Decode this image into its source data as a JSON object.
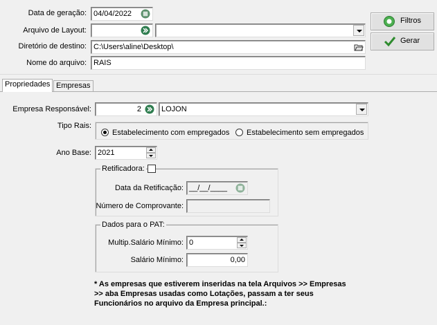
{
  "top": {
    "data_geracao_label": "Data de geração:",
    "data_geracao_value": "04/04/2022",
    "arquivo_layout_label": "Arquivo de Layout:",
    "arquivo_layout_code": "",
    "arquivo_layout_name": "",
    "diretorio_label": "Diretório de destino:",
    "diretorio_value": "C:\\Users\\aline\\Desktop\\",
    "nome_arquivo_label": "Nome do arquivo:",
    "nome_arquivo_value": "RAIS"
  },
  "buttons": {
    "filtros": "Filtros",
    "gerar": "Gerar"
  },
  "tabs": [
    {
      "label": "Propriedades"
    },
    {
      "label": "Empresas"
    }
  ],
  "props": {
    "empresa_label": "Empresa Responsável:",
    "empresa_code": "2",
    "empresa_name": "LOJON",
    "tipo_rais_label": "Tipo Rais:",
    "radio_com": "Estabelecimento com empregados",
    "radio_sem": "Estabelecimento sem empregados",
    "ano_base_label": "Ano Base:",
    "ano_base_value": "2021",
    "retificadora_label": "Retificadora:",
    "data_retificacao_label": "Data da Retificação:",
    "data_retificacao_value": "__/__/____",
    "numero_comprovante_label": "Número de Comprovante:",
    "numero_comprovante_value": "",
    "pat_title": "Dados para o PAT:",
    "mult_salario_label": "Multip.Salário Mínimo:",
    "mult_salario_value": "0",
    "salario_minimo_label": "Salário Mínimo:",
    "salario_minimo_value": "0,00",
    "note_line1": "* As empresas que estiverem inseridas na tela Arquivos >> Empresas",
    "note_line2": ">> aba Empresas usadas como Lotações, passam a ter seus",
    "note_line3": "Funcionários no arquivo da Empresa principal.:"
  },
  "colors": {
    "filtros_icon": "#3c9a3c",
    "go_icon": "#2e8b57",
    "gerar_check": "#2e8b2e"
  }
}
